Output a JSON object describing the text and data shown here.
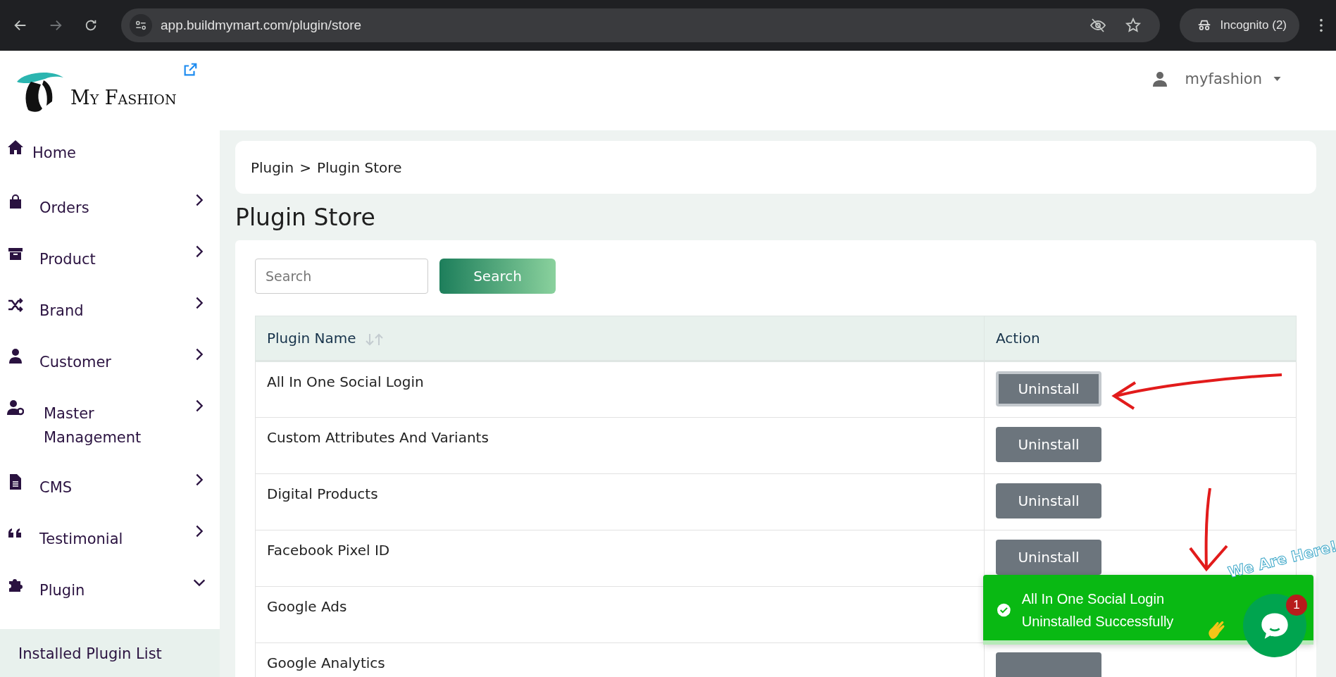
{
  "browser": {
    "url": "app.buildmymart.com/plugin/store",
    "incognito_label": "Incognito (2)"
  },
  "brand": {
    "name": "My Fashion"
  },
  "user": {
    "name": "myfashion"
  },
  "sidebar": {
    "items": [
      {
        "label": "Home"
      },
      {
        "label": "Orders",
        "expanded": false
      },
      {
        "label": "Product",
        "expanded": false
      },
      {
        "label": "Brand",
        "expanded": false
      },
      {
        "label": "Customer",
        "expanded": false
      },
      {
        "label": "Master Management",
        "expanded": false
      },
      {
        "label": "CMS",
        "expanded": false
      },
      {
        "label": "Testimonial",
        "expanded": false
      },
      {
        "label": "Plugin",
        "expanded": true,
        "children": [
          {
            "label": "Installed Plugin List",
            "selected": true
          }
        ]
      }
    ]
  },
  "breadcrumb": [
    "Plugin",
    "Plugin Store"
  ],
  "breadcrumb_separator": ">",
  "page_title": "Plugin Store",
  "search": {
    "placeholder": "Search",
    "button": "Search"
  },
  "table": {
    "columns": [
      {
        "label": "Plugin Name",
        "sortable": true
      },
      {
        "label": "Action",
        "sortable": false
      }
    ],
    "rows": [
      {
        "name": "All In One Social Login",
        "action": "Uninstall",
        "focused": true
      },
      {
        "name": "Custom Attributes And Variants",
        "action": "Uninstall",
        "focused": false
      },
      {
        "name": "Digital Products",
        "action": "Uninstall",
        "focused": false
      },
      {
        "name": "Facebook Pixel ID",
        "action": "Uninstall",
        "focused": false
      },
      {
        "name": "Google Ads"
      },
      {
        "name": "Google Analytics"
      }
    ]
  },
  "toast": {
    "message": "All In One Social Login Uninstalled Successfully"
  },
  "chat_widget": {
    "tagline": "We Are Here!",
    "badge": "1"
  }
}
